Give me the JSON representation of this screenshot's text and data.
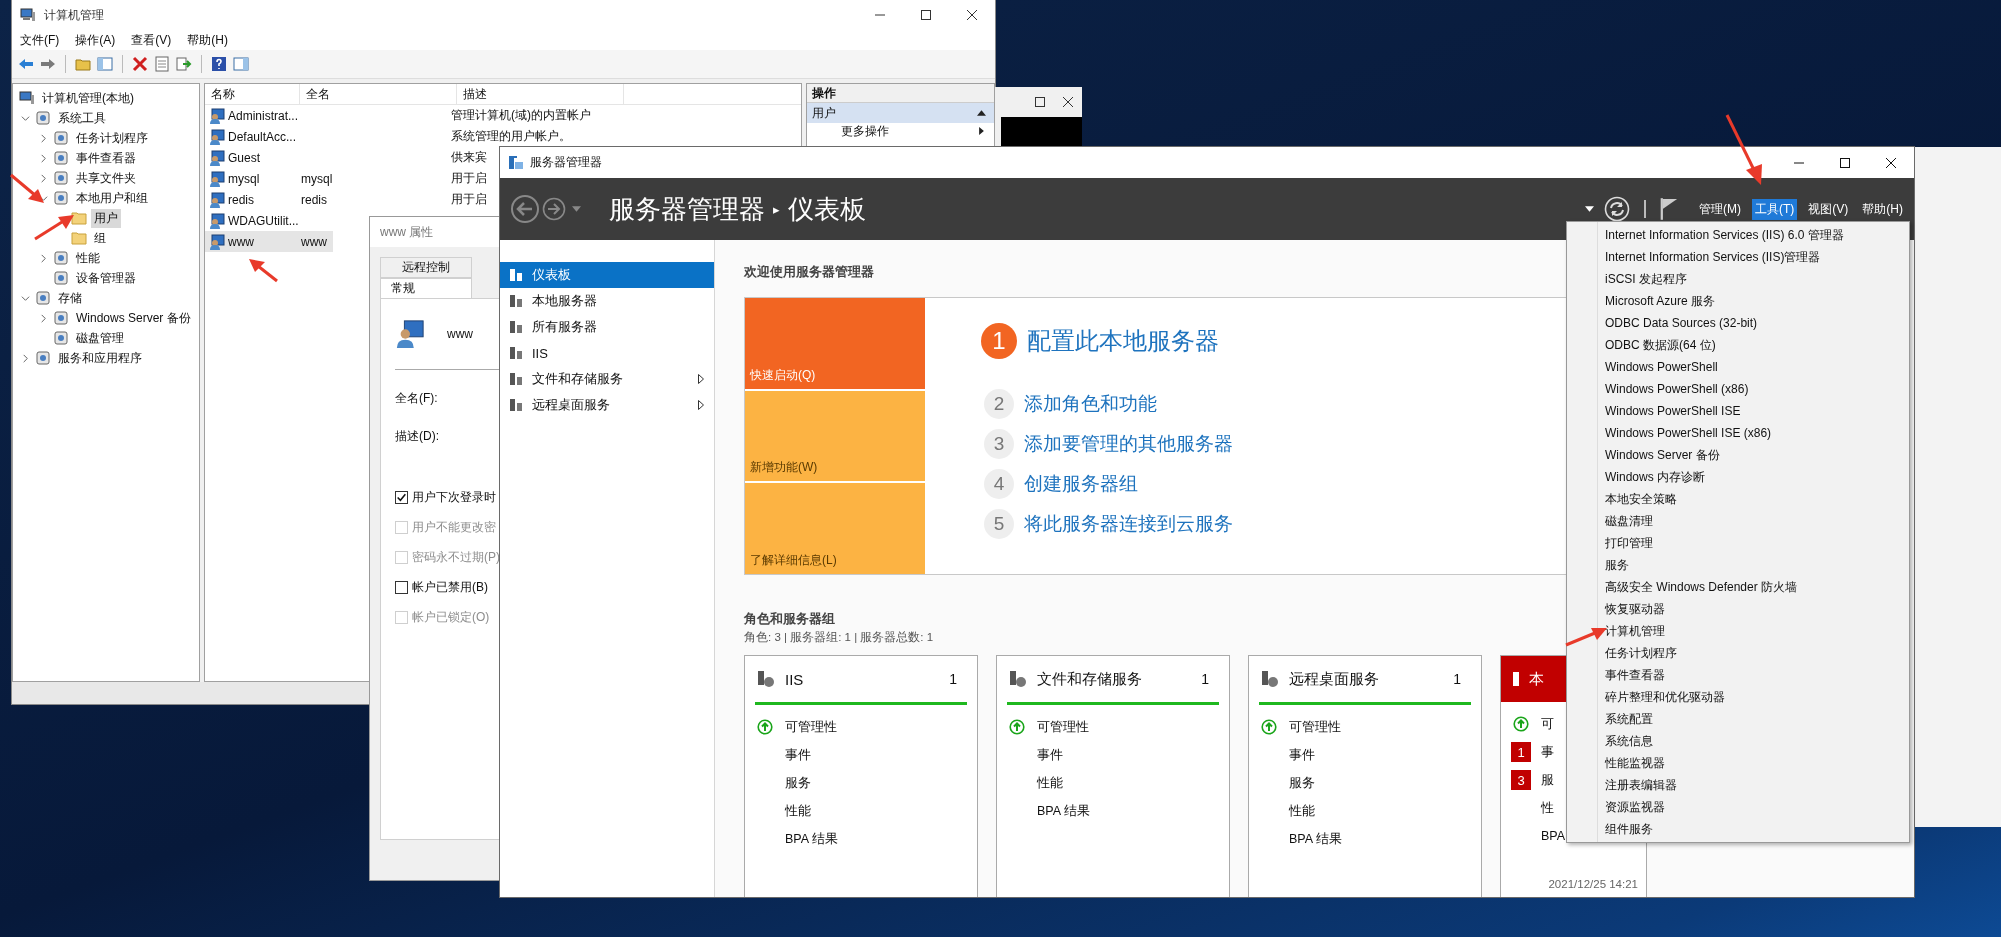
{
  "computer_management": {
    "title": "计算机管理",
    "menu": [
      "文件(F)",
      "操作(A)",
      "查看(V)",
      "帮助(H)"
    ],
    "tree": {
      "root": "计算机管理(本地)",
      "nodes": [
        {
          "label": "系统工具",
          "expanded": true,
          "selected": false,
          "children": [
            {
              "label": "任务计划程序",
              "expanded": false,
              "selected": false
            },
            {
              "label": "事件查看器",
              "expanded": false,
              "selected": false
            },
            {
              "label": "共享文件夹",
              "expanded": false,
              "selected": false
            },
            {
              "label": "本地用户和组",
              "expanded": true,
              "selected": false,
              "children": [
                {
                  "label": "用户",
                  "selected": true
                },
                {
                  "label": "组",
                  "selected": false
                }
              ]
            },
            {
              "label": "性能",
              "expanded": false,
              "selected": false
            },
            {
              "label": "设备管理器",
              "selected": false
            }
          ]
        },
        {
          "label": "存储",
          "expanded": true,
          "selected": false,
          "children": [
            {
              "label": "Windows Server 备份",
              "expanded": false,
              "selected": false
            },
            {
              "label": "磁盘管理",
              "selected": false
            }
          ]
        },
        {
          "label": "服务和应用程序",
          "expanded": false,
          "selected": false
        }
      ]
    },
    "columns": [
      "名称",
      "全名",
      "描述"
    ],
    "rows": [
      {
        "name": "Administrat...",
        "description": "管理计算机(域)的内置帐户",
        "selected": false
      },
      {
        "name": "DefaultAcc...",
        "description": "系统管理的用户帐户。",
        "selected": false
      },
      {
        "name": "Guest",
        "description": "供来宾",
        "selected": false
      },
      {
        "name": "mysql",
        "full_name": "mysql",
        "description": "用于启",
        "selected": false
      },
      {
        "name": "redis",
        "full_name": "redis",
        "description": "用于启",
        "selected": false
      },
      {
        "name": "WDAGUtilit...",
        "selected": false
      },
      {
        "name": "www",
        "full_name": "www",
        "selected": true
      }
    ],
    "actions": {
      "title": "操作",
      "section": "用户",
      "item": "更多操作"
    }
  },
  "properties_dialog": {
    "title": "www 属性",
    "tabs": [
      {
        "label": "远程控制",
        "selected": false
      },
      {
        "label": "常规",
        "selected": true
      }
    ],
    "user": "www",
    "fields": [
      "全名(F):",
      "描述(D):"
    ],
    "options": [
      {
        "label": "用户下次登录时",
        "checked": true,
        "disabled": false
      },
      {
        "label": "用户不能更改密",
        "checked": false,
        "disabled": true
      },
      {
        "label": "密码永不过期(P)",
        "checked": false,
        "disabled": true
      },
      {
        "label": "帐户已禁用(B)",
        "checked": false,
        "disabled": false
      },
      {
        "label": "帐户已锁定(O)",
        "checked": false,
        "disabled": true
      }
    ]
  },
  "server_manager": {
    "title": "服务器管理器",
    "breadcrumb": {
      "app": "服务器管理器",
      "separator": "▸",
      "page": "仪表板"
    },
    "menu": [
      {
        "label": "管理(M)",
        "selected": false
      },
      {
        "label": "工具(T)",
        "selected": true
      },
      {
        "label": "视图(V)",
        "selected": false
      },
      {
        "label": "帮助(H)",
        "selected": false
      }
    ],
    "sidebar": [
      {
        "label": "仪表板",
        "selected": true,
        "submenu": false
      },
      {
        "label": "本地服务器",
        "selected": false,
        "submenu": false
      },
      {
        "label": "所有服务器",
        "selected": false,
        "submenu": false
      },
      {
        "label": "IIS",
        "selected": false,
        "submenu": false
      },
      {
        "label": "文件和存储服务",
        "selected": false,
        "submenu": true
      },
      {
        "label": "远程桌面服务",
        "selected": false,
        "submenu": true
      }
    ],
    "welcome": "欢迎使用服务器管理器",
    "quick_tiles": [
      {
        "label": "快速启动(Q)",
        "selected": true
      },
      {
        "label": "新增功能(W)",
        "selected": false
      },
      {
        "label": "了解详细信息(L)",
        "selected": false
      }
    ],
    "steps": [
      {
        "number": "1",
        "label": "配置此本地服务器",
        "kind": "primary"
      },
      {
        "number": "2",
        "label": "添加角色和功能",
        "kind": "secondary"
      },
      {
        "number": "3",
        "label": "添加要管理的其他服务器",
        "kind": "secondary"
      },
      {
        "number": "4",
        "label": "创建服务器组",
        "kind": "secondary"
      },
      {
        "number": "5",
        "label": "将此服务器连接到云服务",
        "kind": "secondary"
      }
    ],
    "roles_title": "角色和服务器组",
    "roles_summary": "角色: 3 | 服务器组: 1 | 服务器总数: 1",
    "role_cards": [
      {
        "title": "IIS",
        "count": "1",
        "alert": false,
        "rows": [
          {
            "kind": "status",
            "label": "可管理性"
          },
          {
            "kind": "plain",
            "label": "事件"
          },
          {
            "kind": "plain",
            "label": "服务"
          },
          {
            "kind": "plain",
            "label": "性能"
          },
          {
            "kind": "plain",
            "label": "BPA 结果"
          }
        ]
      },
      {
        "title": "文件和存储服务",
        "count": "1",
        "alert": false,
        "rows": [
          {
            "kind": "status",
            "label": "可管理性"
          },
          {
            "kind": "plain",
            "label": "事件"
          },
          {
            "kind": "plain",
            "label": "性能"
          },
          {
            "kind": "plain",
            "label": "BPA 结果"
          }
        ]
      },
      {
        "title": "远程桌面服务",
        "count": "1",
        "alert": false,
        "rows": [
          {
            "kind": "status",
            "label": "可管理性"
          },
          {
            "kind": "plain",
            "label": "事件"
          },
          {
            "kind": "plain",
            "label": "服务"
          },
          {
            "kind": "plain",
            "label": "性能"
          },
          {
            "kind": "plain",
            "label": "BPA 结果"
          }
        ]
      },
      {
        "title": "本",
        "alert": true,
        "timestamp": "2021/12/25 14:21",
        "rows": [
          {
            "kind": "status",
            "label": "可"
          },
          {
            "kind": "badge",
            "badge": "1",
            "label": "事"
          },
          {
            "kind": "badge",
            "badge": "3",
            "label": "服"
          },
          {
            "kind": "plain",
            "label": "性"
          },
          {
            "kind": "plain",
            "label": "BPA"
          }
        ]
      }
    ]
  },
  "tools_menu": [
    "Internet Information Services (IIS) 6.0 管理器",
    "Internet Information Services (IIS)管理器",
    "iSCSI 发起程序",
    "Microsoft Azure 服务",
    "ODBC Data Sources (32-bit)",
    "ODBC 数据源(64 位)",
    "Windows PowerShell",
    "Windows PowerShell (x86)",
    "Windows PowerShell ISE",
    "Windows PowerShell ISE (x86)",
    "Windows Server 备份",
    "Windows 内存诊断",
    "本地安全策略",
    "磁盘清理",
    "打印管理",
    "服务",
    "高级安全 Windows Defender 防火墙",
    "恢复驱动器",
    "计算机管理",
    "任务计划程序",
    "事件查看器",
    "碎片整理和优化驱动器",
    "系统配置",
    "系统信息",
    "性能监视器",
    "注册表编辑器",
    "资源监视器",
    "组件服务"
  ]
}
